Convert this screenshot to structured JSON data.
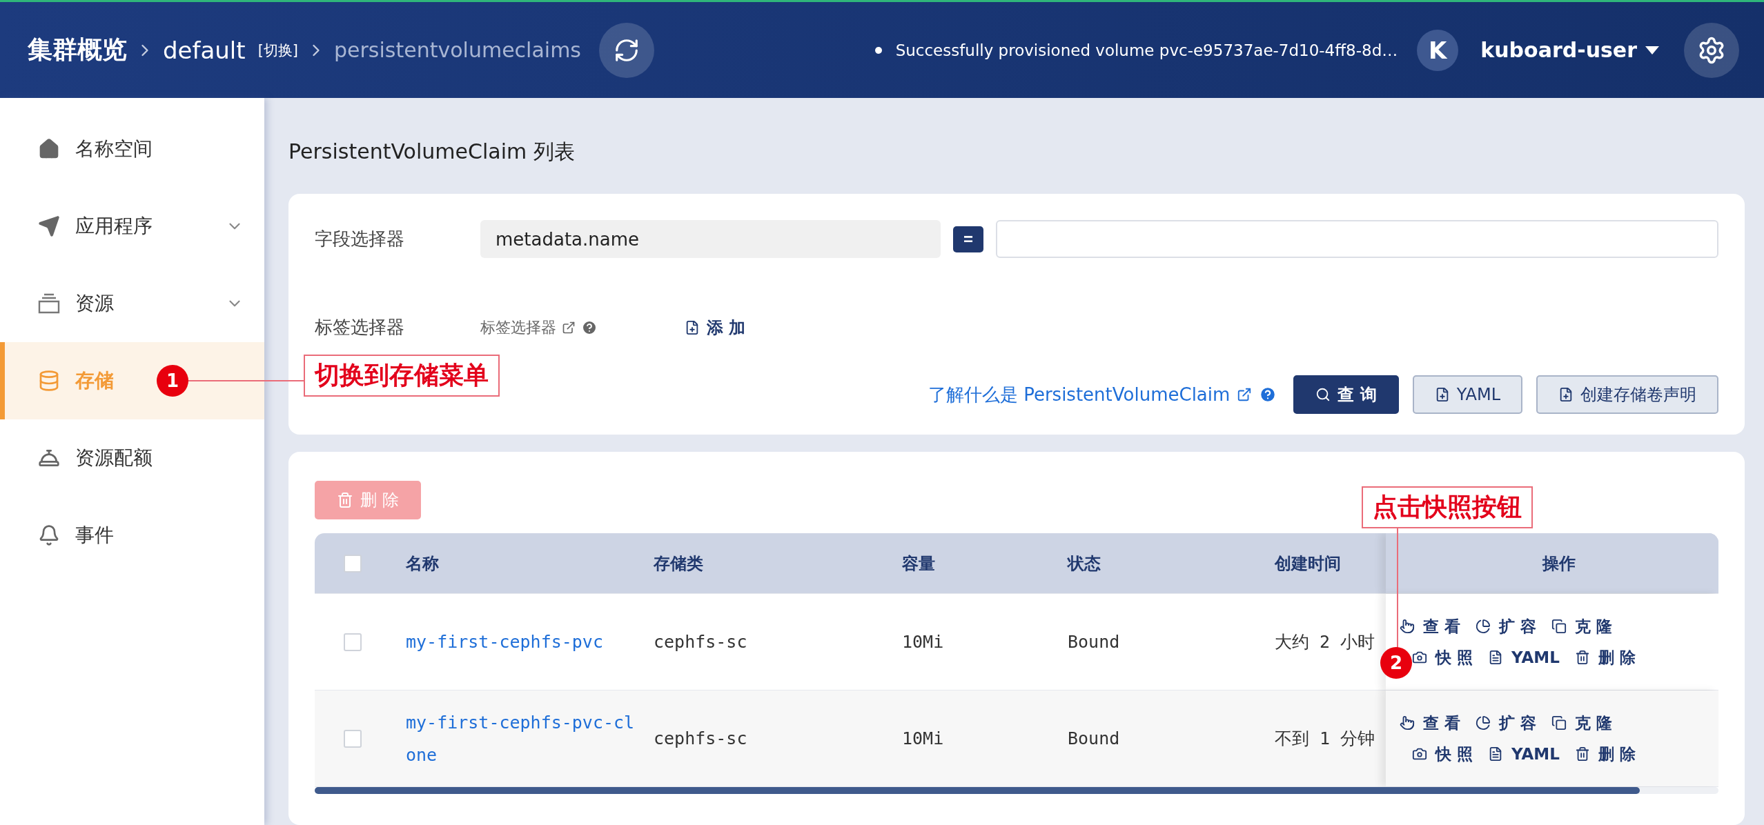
{
  "header": {
    "breadcrumb": [
      {
        "kind": "root",
        "text": "集群概览"
      },
      {
        "kind": "namespace",
        "text": "default",
        "switch": "[切换]"
      },
      {
        "kind": "resource",
        "text": "persistentvolumeclaims"
      }
    ],
    "notification": "Successfully provisioned volume pvc-e95737ae-7d10-4ff8-8d…",
    "avatar": "K",
    "user": "kuboard-user"
  },
  "sidebar": {
    "items": [
      {
        "label": "名称空间",
        "selected": false,
        "expandable": false
      },
      {
        "label": "应用程序",
        "selected": false,
        "expandable": true
      },
      {
        "label": "资源",
        "selected": false,
        "expandable": true
      },
      {
        "label": "存储",
        "selected": true,
        "expandable": false
      },
      {
        "label": "资源配额",
        "selected": false,
        "expandable": false
      },
      {
        "label": "事件",
        "selected": false,
        "expandable": false
      }
    ]
  },
  "page_title": "PersistentVolumeClaim 列表",
  "filter": {
    "field_selector": {
      "label": "字段选择器",
      "key": "metadata.name",
      "operator": "="
    },
    "label_selector": {
      "label": "标签选择器",
      "link": "标签选择器",
      "add": "添 加"
    },
    "learn_link": "了解什么是 PersistentVolumeClaim",
    "buttons": [
      {
        "kind": "primary",
        "label": "查 询"
      },
      {
        "kind": "plain",
        "label": "YAML"
      },
      {
        "kind": "plain",
        "label": "创建存储卷声明"
      }
    ]
  },
  "table": {
    "delete_button": {
      "label": "删 除",
      "disabled": true
    },
    "select_all": false,
    "columns": [
      "名称",
      "存储类",
      "容量",
      "状态",
      "创建时间",
      "操作"
    ],
    "rows": [
      {
        "checked": false,
        "name": "my-first-cephfs-pvc",
        "storage_class": "cephfs-sc",
        "capacity": "10Mi",
        "status": "Bound",
        "created": "大约 2 小时",
        "actions": [
          {
            "kind": "view",
            "label": "查 看"
          },
          {
            "kind": "expand",
            "label": "扩 容"
          },
          {
            "kind": "clone",
            "label": "克 隆"
          },
          {
            "kind": "snapshot",
            "label": "快 照"
          },
          {
            "kind": "yaml",
            "label": "YAML"
          },
          {
            "kind": "delete",
            "label": "删 除"
          }
        ]
      },
      {
        "checked": false,
        "name": "my-first-cephfs-pvc-clone",
        "storage_class": "cephfs-sc",
        "capacity": "10Mi",
        "status": "Bound",
        "created": "不到 1 分钟",
        "actions": [
          {
            "kind": "view",
            "label": "查 看"
          },
          {
            "kind": "expand",
            "label": "扩 容"
          },
          {
            "kind": "clone",
            "label": "克 隆"
          },
          {
            "kind": "snapshot",
            "label": "快 照"
          },
          {
            "kind": "yaml",
            "label": "YAML"
          },
          {
            "kind": "delete",
            "label": "删 除"
          }
        ]
      }
    ]
  },
  "annotations": [
    {
      "number": "1",
      "text": "切换到存储菜单"
    },
    {
      "number": "2",
      "text": "点击快照按钮"
    }
  ]
}
